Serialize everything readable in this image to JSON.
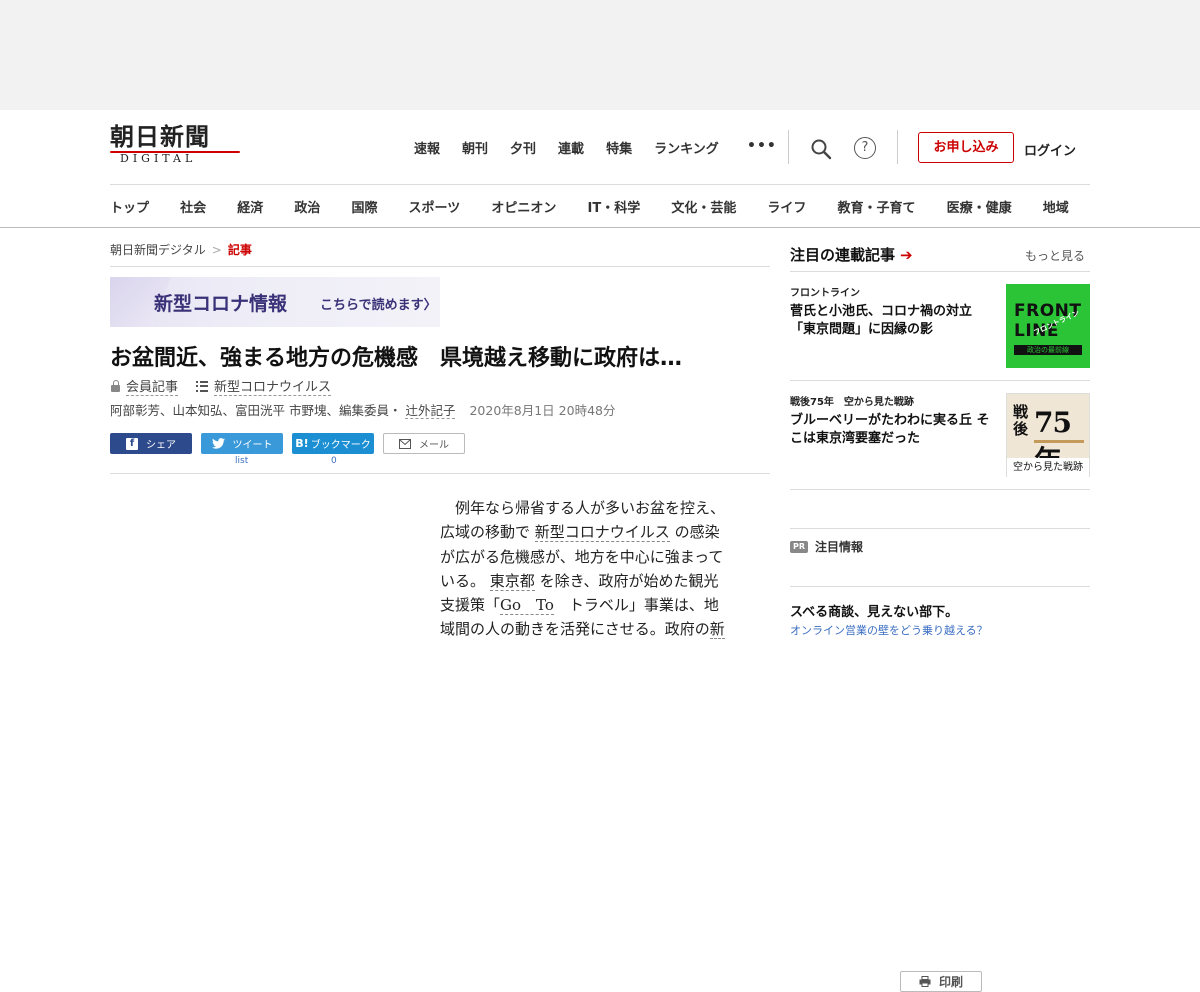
{
  "header": {
    "logo_jp": "朝日新聞",
    "logo_en": "DIGITAL",
    "topnav": [
      "速報",
      "朝刊",
      "夕刊",
      "連載",
      "特集",
      "ランキング"
    ],
    "more": "•••",
    "apply_label": "お申し込み",
    "login_label": "ログイン",
    "help": "?"
  },
  "categories": [
    "トップ",
    "社会",
    "経済",
    "政治",
    "国際",
    "スポーツ",
    "オピニオン",
    "IT・科学",
    "文化・芸能",
    "ライフ",
    "教育・子育て",
    "医療・健康",
    "地域"
  ],
  "breadcrumb": {
    "home": "朝日新聞デジタル",
    "sep": ">",
    "current": "記事"
  },
  "banner": {
    "title": "新型コロナ情報",
    "cta": "こちらで読めます〉"
  },
  "article": {
    "headline": "お盆間近、強まる地方の危機感　県境越え移動に政府は…",
    "member": "会員記事",
    "topic": "新型コロナウイルス",
    "authors": "阿部彰芳、山本知弘、富田洸平 市野塊、編集委員・",
    "author_link": "辻外記子",
    "date": "2020年8月1日 20時48分",
    "body_lines": [
      "　例年なら帰省する人が多いお盆を控え、",
      "広域の移動で",
      "新型コロナウイルス",
      "の感染",
      "が広がる危機感が、地方を中心に強まって",
      "いる。",
      "東京都",
      "を除き、政府が始めた観光",
      "支援策「",
      "Go　To",
      "　トラベル」事業は、地",
      "域間の人の動きを活発にさせる。政府の",
      "新"
    ]
  },
  "share": {
    "facebook": "シェア",
    "twitter": "ツイート",
    "hatena": "ブックマーク",
    "mail": "メール",
    "print": "印刷",
    "twitter_count": "list",
    "hatena_count": "0"
  },
  "sidebar": {
    "title": "注目の連載記事",
    "more": "もっと見る",
    "items": [
      {
        "kicker": "フロントライン",
        "title": "菅氏と小池氏、コロナ禍の対立「東京問題」に因縁の影"
      },
      {
        "kicker": "戦後75年　空から見た戦跡",
        "title": "ブルーベリーがたわわに実る丘 そこは東京湾要塞だった"
      }
    ],
    "thumb1": {
      "main": "FRONT LINE",
      "arc": "フロントライン",
      "sub": "政治の最前線"
    },
    "thumb2": {
      "a": "戦後",
      "b": "75年",
      "c": "空から見た戦跡"
    },
    "pr_badge": "PR",
    "pr_label": "注目情報",
    "ad_title": "スベる商談、見えない部下。",
    "ad_sub": "オンライン営業の壁をどう乗り越える？"
  },
  "colors": {
    "brand_red": "#cc0000",
    "facebook": "#2d4a8c",
    "twitter": "#3a9ad9",
    "hatena": "#1c8fd3",
    "frontline_green": "#2bc436"
  }
}
